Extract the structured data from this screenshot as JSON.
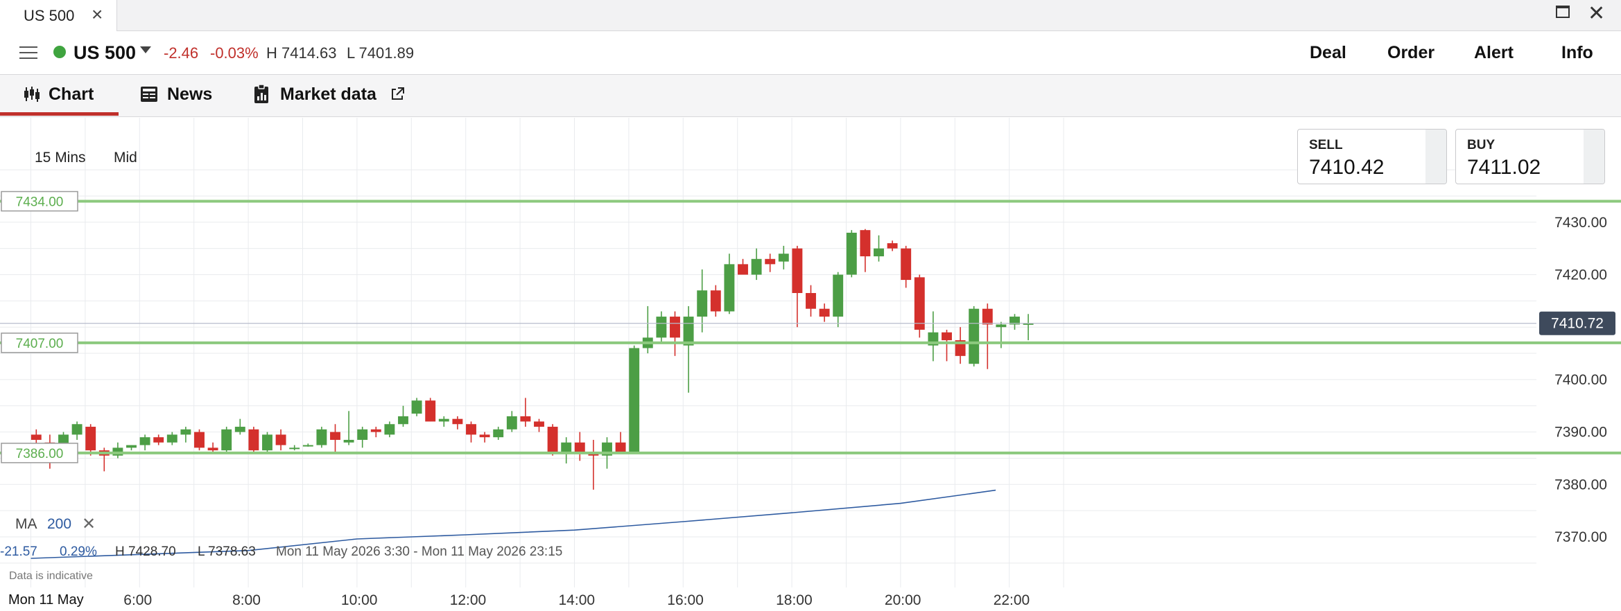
{
  "window": {
    "tab_title": "US 500",
    "tab_close": "×",
    "close_glyph": "✕"
  },
  "instrument": {
    "name": "US 500",
    "change": "-2.46",
    "change_pct": "-0.03%",
    "high": "H 7414.63",
    "low": "L 7401.89",
    "status_color": "#3fa43f"
  },
  "actions": {
    "deal": "Deal",
    "order": "Order",
    "alert": "Alert",
    "info": "Info"
  },
  "tabs": [
    {
      "label": "Chart",
      "icon": "candlestick-icon",
      "active": true
    },
    {
      "label": "News",
      "icon": "newspaper-icon"
    },
    {
      "label": "Market data",
      "icon": "clipboard-chart-icon",
      "external_icon": "external-link-icon"
    }
  ],
  "chart_settings": {
    "interval": "15 Mins",
    "price_type": "Mid"
  },
  "quotes": {
    "sell_label": "SELL",
    "sell_value": "7410.42",
    "buy_label": "BUY",
    "buy_value": "7411.02"
  },
  "indicator": {
    "label": "MA",
    "period": "200",
    "remove": "✕"
  },
  "info_bar": {
    "change": "-21.57",
    "change_pct": "0.29%",
    "high": "H 7428.70",
    "low": "L 7378.63",
    "range": "Mon 11 May 2026 3:30 - Mon 11 May 2026 23:15",
    "disclaimer": "Data is indicative"
  },
  "chart_data": {
    "type": "candlestick",
    "date_label": "Mon 11 May",
    "x_ticks": [
      "6:00",
      "8:00",
      "10:00",
      "12:00",
      "14:00",
      "16:00",
      "18:00",
      "20:00",
      "22:00"
    ],
    "y_ticks": [
      "7370.00",
      "7380.00",
      "7390.00",
      "7400.00",
      "7410.00",
      "7420.00",
      "7430.00"
    ],
    "ylim": [
      7363,
      7442
    ],
    "first_hour": 4.0,
    "bar_hours": 0.25,
    "current_price": {
      "value": 7410.72,
      "label": "7410.72"
    },
    "alert_lines": [
      {
        "value": 7434.0,
        "label": "7434.00"
      },
      {
        "value": 7407.0,
        "label": "7407.00"
      },
      {
        "value": 7386.0,
        "label": "7386.00"
      }
    ],
    "colors": {
      "up": "#4c9e45",
      "down": "#d4302c",
      "alert": "#8cc97e",
      "ma": "#2d5aa0",
      "grid": "#e9ebee",
      "price_tag": "#3e4a5c"
    },
    "moving_average": [
      {
        "t": 4.0,
        "v": 7365.9
      },
      {
        "t": 8.0,
        "v": 7367.4
      },
      {
        "t": 10.0,
        "v": 7369.6
      },
      {
        "t": 12.0,
        "v": 7370.4
      },
      {
        "t": 14.0,
        "v": 7371.3
      },
      {
        "t": 16.0,
        "v": 7372.9
      },
      {
        "t": 18.0,
        "v": 7374.6
      },
      {
        "t": 20.0,
        "v": 7376.4
      },
      {
        "t": 21.75,
        "v": 7378.9
      }
    ],
    "candles": [
      [
        7389.5,
        7390.5,
        7387.5,
        7388.5
      ],
      [
        7388.0,
        7389.5,
        7383.0,
        7387.0
      ],
      [
        7387.5,
        7390.0,
        7386.0,
        7389.5
      ],
      [
        7389.5,
        7392.0,
        7388.5,
        7391.5
      ],
      [
        7391.0,
        7391.5,
        7385.5,
        7386.5
      ],
      [
        7386.5,
        7387.0,
        7382.5,
        7385.5
      ],
      [
        7385.5,
        7388.0,
        7385.0,
        7387.0
      ],
      [
        7387.0,
        7387.5,
        7386.5,
        7387.5
      ],
      [
        7387.5,
        7389.5,
        7386.5,
        7389.0
      ],
      [
        7389.0,
        7389.5,
        7387.5,
        7388.0
      ],
      [
        7388.0,
        7390.0,
        7387.5,
        7389.5
      ],
      [
        7389.5,
        7391.0,
        7388.0,
        7390.5
      ],
      [
        7390.0,
        7390.5,
        7386.5,
        7387.0
      ],
      [
        7387.0,
        7388.0,
        7386.0,
        7386.5
      ],
      [
        7386.5,
        7391.0,
        7386.0,
        7390.5
      ],
      [
        7390.0,
        7392.5,
        7389.5,
        7391.0
      ],
      [
        7390.5,
        7391.0,
        7386.0,
        7386.5
      ],
      [
        7386.5,
        7390.0,
        7386.0,
        7389.5
      ],
      [
        7389.5,
        7390.5,
        7386.5,
        7387.5
      ],
      [
        7387.0,
        7387.5,
        7386.5,
        7387.0
      ],
      [
        7387.5,
        7387.8,
        7387.2,
        7387.5
      ],
      [
        7387.5,
        7391.0,
        7387.0,
        7390.5
      ],
      [
        7390.0,
        7391.5,
        7386.0,
        7388.5
      ],
      [
        7388.0,
        7394.0,
        7387.5,
        7388.5
      ],
      [
        7388.5,
        7391.0,
        7387.0,
        7390.5
      ],
      [
        7390.5,
        7391.0,
        7389.0,
        7390.0
      ],
      [
        7389.5,
        7392.0,
        7389.0,
        7391.5
      ],
      [
        7391.5,
        7395.0,
        7391.0,
        7393.0
      ],
      [
        7393.5,
        7396.5,
        7393.0,
        7396.0
      ],
      [
        7396.0,
        7396.5,
        7392.0,
        7392.0
      ],
      [
        7392.0,
        7393.0,
        7391.0,
        7392.5
      ],
      [
        7392.5,
        7393.0,
        7390.5,
        7391.5
      ],
      [
        7391.5,
        7392.0,
        7388.0,
        7389.5
      ],
      [
        7389.5,
        7390.0,
        7388.0,
        7389.0
      ],
      [
        7389.0,
        7391.0,
        7388.5,
        7390.5
      ],
      [
        7390.5,
        7394.0,
        7390.0,
        7393.0
      ],
      [
        7393.0,
        7396.5,
        7391.0,
        7392.0
      ],
      [
        7392.0,
        7392.5,
        7390.0,
        7391.0
      ],
      [
        7391.0,
        7391.5,
        7385.5,
        7386.0
      ],
      [
        7386.0,
        7389.0,
        7384.0,
        7388.0
      ],
      [
        7388.0,
        7390.0,
        7384.5,
        7386.0
      ],
      [
        7386.0,
        7388.5,
        7379.0,
        7385.5
      ],
      [
        7385.5,
        7389.0,
        7383.0,
        7388.0
      ],
      [
        7388.0,
        7390.0,
        7386.0,
        7386.0
      ],
      [
        7386.0,
        7406.5,
        7386.0,
        7406.0
      ],
      [
        7406.0,
        7414.0,
        7405.0,
        7408.0
      ],
      [
        7408.0,
        7413.0,
        7407.0,
        7412.0
      ],
      [
        7412.0,
        7413.0,
        7404.5,
        7408.0
      ],
      [
        7406.5,
        7414.0,
        7397.5,
        7412.0
      ],
      [
        7412.0,
        7421.0,
        7409.0,
        7417.0
      ],
      [
        7417.0,
        7418.0,
        7412.0,
        7413.0
      ],
      [
        7413.0,
        7424.0,
        7412.5,
        7422.0
      ],
      [
        7422.0,
        7423.0,
        7420.0,
        7420.0
      ],
      [
        7420.0,
        7425.0,
        7419.0,
        7423.0
      ],
      [
        7423.0,
        7424.0,
        7420.5,
        7422.0
      ],
      [
        7422.5,
        7425.5,
        7421.0,
        7424.0
      ],
      [
        7425.0,
        7425.5,
        7410.0,
        7416.5
      ],
      [
        7416.5,
        7418.0,
        7412.0,
        7413.5
      ],
      [
        7413.5,
        7414.5,
        7411.0,
        7412.0
      ],
      [
        7412.0,
        7420.5,
        7410.0,
        7420.0
      ],
      [
        7420.0,
        7428.5,
        7419.5,
        7428.0
      ],
      [
        7428.5,
        7428.7,
        7420.5,
        7423.5
      ],
      [
        7423.5,
        7427.5,
        7422.5,
        7425.0
      ],
      [
        7426.0,
        7426.5,
        7424.5,
        7425.0
      ],
      [
        7425.0,
        7425.5,
        7417.5,
        7419.0
      ],
      [
        7419.5,
        7420.0,
        7408.0,
        7409.5
      ],
      [
        7406.5,
        7413.0,
        7403.5,
        7409.0
      ],
      [
        7409.0,
        7409.5,
        7403.5,
        7407.5
      ],
      [
        7407.5,
        7410.0,
        7403.0,
        7404.5
      ],
      [
        7403.0,
        7414.0,
        7402.5,
        7413.5
      ],
      [
        7413.5,
        7414.5,
        7402.0,
        7410.5
      ],
      [
        7410.0,
        7411.0,
        7406.0,
        7410.5
      ],
      [
        7410.5,
        7412.5,
        7409.5,
        7412.0
      ],
      [
        7410.5,
        7412.5,
        7407.5,
        7410.7
      ]
    ]
  }
}
